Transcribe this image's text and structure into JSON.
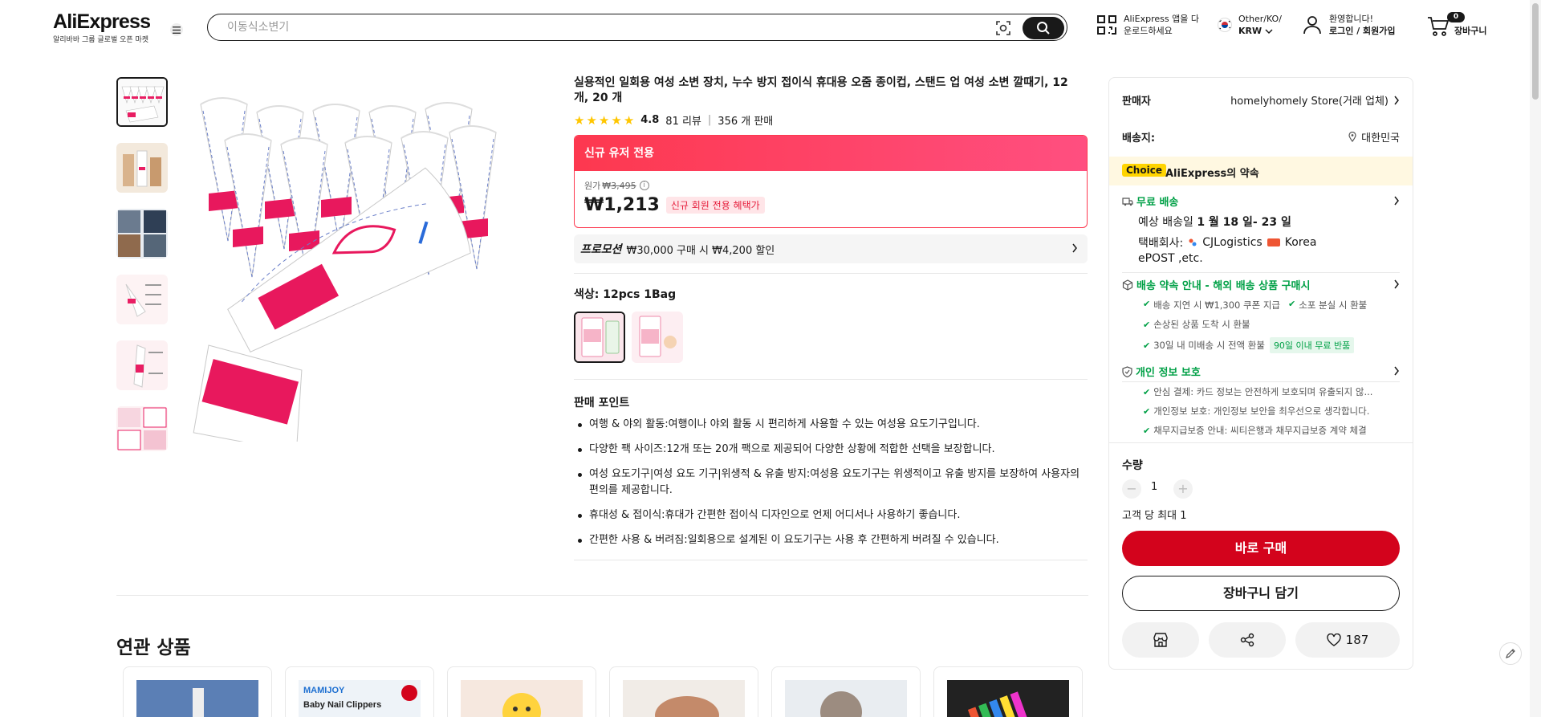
{
  "header": {
    "logo": "AliExpress",
    "logo_sub": "알리바바 그룹 글로벌 오픈 마켓",
    "search_placeholder": "이동식소변기",
    "app_line1": "AliExpress 앱을 다",
    "app_line2": "운로드하세요",
    "locale_line1": "Other/KO/",
    "locale_line2": "KRW",
    "welcome_line1": "환영합니다!",
    "welcome_line2": "로그인 / 회원가입",
    "cart_count": "0",
    "cart_label": "장바구니"
  },
  "product": {
    "title": "실용적인 일회용 여성 소변 장치, 누수 방지 접이식 휴대용 오줌 종이컵, 스탠드 업 여성 소변 깔때기, 12개, 20 개",
    "rating": "4.8",
    "reviews": "81 리뷰",
    "sold": "356 개 판매",
    "deal_header": "신규 유저 전용",
    "orig_label": "원가",
    "orig_price": "₩3,495",
    "price": "₩1,213",
    "price_tag": "신규 회원 전용 혜택가",
    "promo_label": "프로모션",
    "promo_text": "₩30,000 구매 시 ₩4,200 할인",
    "color_label": "색상: 12pcs 1Bag",
    "selling_title": "판매 포인트",
    "selling_points": [
      "여행 & 야외 활동:여행이나 야외 활동 시 편리하게 사용할 수 있는 여성용 요도기구입니다.",
      "다양한 팩 사이즈:12개 또는 20개 팩으로 제공되어 다양한 상황에 적합한 선택을 보장합니다.",
      "여성 요도기구|여성 요도 기구|위생적 & 유출 방지:여성용 요도기구는 위생적이고 유출 방지를 보장하여 사용자의 편의를 제공합니다.",
      "휴대성 & 접이식:휴대가 간편한 접이식 디자인으로 언제 어디서나 사용하기 좋습니다.",
      "간편한 사용 & 버려짐:일회용으로 설계된 이 요도기구는 사용 후 간편하게 버려질 수 있습니다."
    ],
    "related_title": "연관 상품"
  },
  "panel": {
    "seller_label": "판매자",
    "seller_name": "homelyhomely Store(거래 업체)",
    "ship_to_label": "배송지:",
    "ship_to": "대한민국",
    "choice_badge": "Choice",
    "choice_text": "AliExpress의 약속",
    "free_ship": "무료 배송",
    "eta_prefix": "예상 배송일",
    "eta_dates": "1 월 18 일- 23 일",
    "carrier_label": "택배회사:",
    "carrier1": "CJLogistics",
    "carrier2": "Korea",
    "carrier3": "ePOST ,etc.",
    "promise_title": "배송 약속 안내 - 해외 배송 상품 구매시",
    "promise1": "배송 지연 시 ₩1,300 쿠폰 지급",
    "promise2": "소포 분실 시 환불",
    "promise3": "손상된 상품 도착 시 환불",
    "promise4": "30일 내 미배송 시 전액 환불",
    "promise_pill": "90일 이내 무료 반품",
    "privacy_title": "개인 정보 보호",
    "privacy1": "안심 결제: 카드 정보는 안전하게 보호되며 유출되지 않...",
    "privacy2": "개인정보 보호: 개인정보 보안을 최우선으로 생각합니다.",
    "privacy3": "채무지급보증 안내: 씨티은행과 채무지급보증 계약 체결",
    "qty_label": "수량",
    "qty_value": "1",
    "qty_limit": "고객 당 최대 1",
    "buy_now": "바로 구매",
    "add_cart": "장바구니 담기",
    "wish_count": "187"
  },
  "colors": {
    "brand_red": "#d3031c",
    "deal_gradient_start": "#fd384f",
    "deal_gradient_end": "#ff4f80",
    "green": "#00a046",
    "star": "#ffc600"
  }
}
